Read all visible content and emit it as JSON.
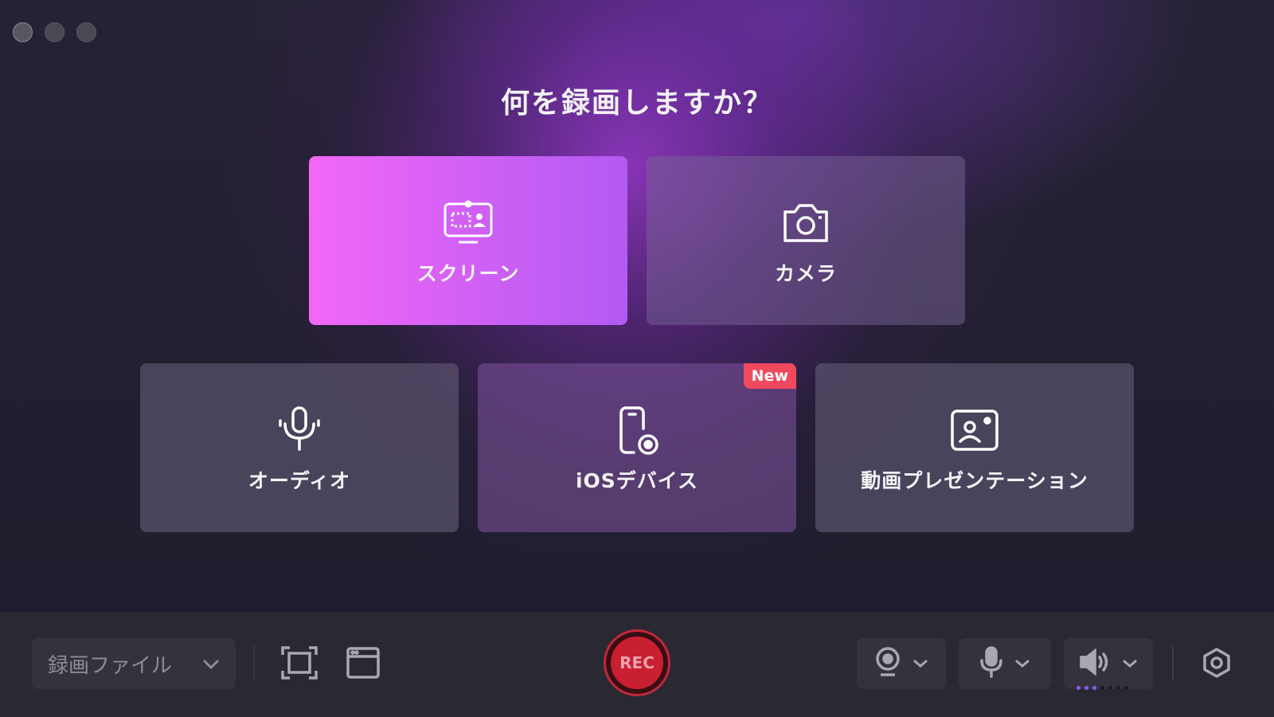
{
  "window": {
    "controls": [
      "close",
      "minimize",
      "zoom"
    ]
  },
  "heading": "何を録画しますか？",
  "cards": {
    "screen": {
      "label": "スクリーン",
      "icon": "screen-record-icon"
    },
    "camera": {
      "label": "カメラ",
      "icon": "camera-icon"
    },
    "audio": {
      "label": "オーディオ",
      "icon": "microphone-icon"
    },
    "ios": {
      "label": "iOSデバイス",
      "icon": "ios-device-icon",
      "badge": "New"
    },
    "presentation": {
      "label": "動画プレゼンテーション",
      "icon": "presentation-icon"
    }
  },
  "toolbar": {
    "output_select": {
      "value": "録画ファイル"
    },
    "rec_label": "REC",
    "audio_level": {
      "active_bars": 3,
      "total_bars": 7
    }
  },
  "colors": {
    "accent_start": "#f368f6",
    "accent_end": "#b25af2",
    "rec_red": "#c81f31",
    "badge_red": "#f0495f"
  }
}
